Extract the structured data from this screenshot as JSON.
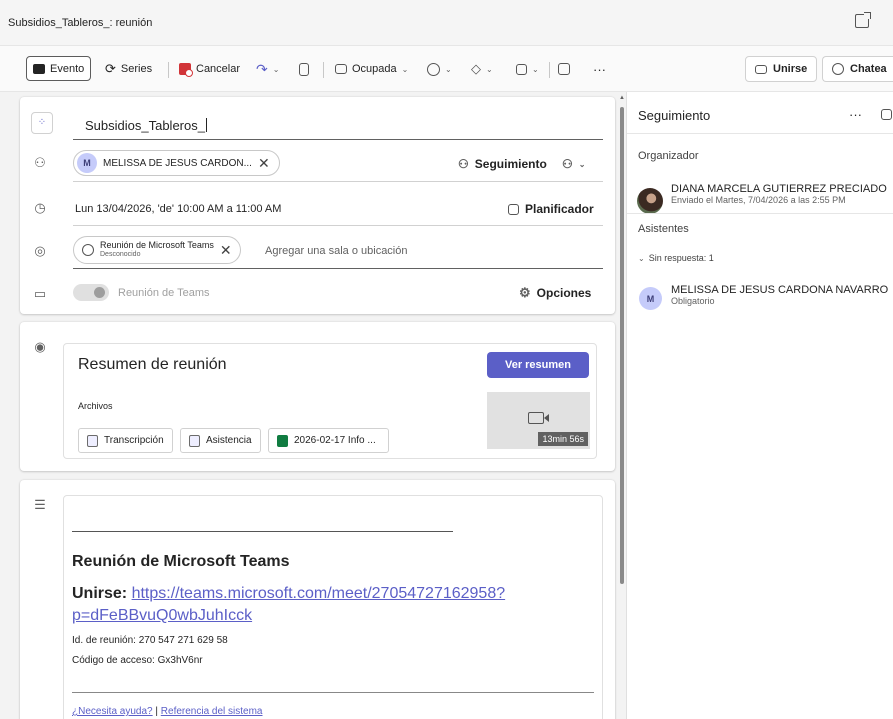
{
  "window": {
    "title": "Subsidios_Tableros_: reunión"
  },
  "toolbar": {
    "evento": "Evento",
    "series": "Series",
    "cancelar": "Cancelar",
    "ocupada": "Ocupada",
    "unirse": "Unirse",
    "chatear": "Chatea"
  },
  "form": {
    "title": "Subsidios_Tableros_",
    "attendee": {
      "initial": "M",
      "name": "MELISSA DE JESUS CARDON..."
    },
    "seguimiento": "Seguimiento",
    "datetime": "Lun 13/04/2026, 'de' 10:00 AM a 11:00 AM",
    "planificador": "Planificador",
    "location": {
      "name": "Reunión de Microsoft Teams",
      "status": "Desconocido",
      "placeholder": "Agregar una sala o ubicación"
    },
    "teams_label": "Reunión de Teams",
    "opciones": "Opciones"
  },
  "summary": {
    "title": "Resumen de reunión",
    "button": "Ver resumen",
    "archivos": "Archivos",
    "files": [
      "Transcripción",
      "Asistencia",
      "2026-02-17 Info ..."
    ],
    "duration": "13min 56s"
  },
  "body": {
    "heading": "Reunión de Microsoft Teams",
    "join_label": "Unirse:",
    "join_url_1": "https://teams.microsoft.com/meet/27054727162958?",
    "join_url_2": "p=dFeBBvuQ0wbJuhIcck",
    "meeting_id": "Id. de reunión: 270 547 271 629 58",
    "access_code": "Código de acceso: Gx3hV6nr",
    "help": "¿Necesita ayuda?",
    "sep": "|",
    "ref": "Referencia del sistema"
  },
  "panel": {
    "title": "Seguimiento",
    "more": "···",
    "organizer_label": "Organizador",
    "organizer_name": "DIANA MARCELA GUTIERREZ PRECIADO",
    "organizer_sent": "Enviado el Martes, 7/04/2026 a las 2:55 PM",
    "attendees_label": "Asistentes",
    "no_response": "Sin respuesta: 1",
    "attendee_initial": "M",
    "attendee_name": "MELISSA DE JESUS CARDONA NAVARRO",
    "attendee_role": "Obligatorio"
  }
}
